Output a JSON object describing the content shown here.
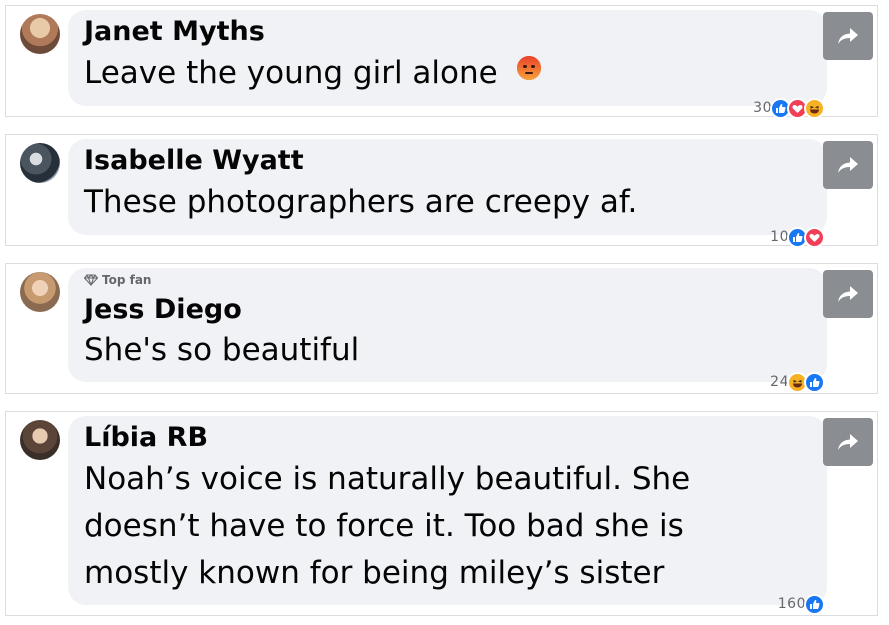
{
  "comments": [
    {
      "author": "Janet Myths",
      "text_lines": [
        "Leave the young girl alone"
      ],
      "inline_emoji": "angry-face-icon",
      "badge": "",
      "reaction_count": "30",
      "reactions": [
        "like-icon",
        "love-icon",
        "haha-icon"
      ]
    },
    {
      "author": "Isabelle Wyatt",
      "text_lines": [
        "These photographers are creepy af."
      ],
      "badge": "",
      "reaction_count": "10",
      "reactions": [
        "like-icon",
        "love-icon"
      ]
    },
    {
      "author": "Jess Diego",
      "text_lines": [
        "She's so beautiful"
      ],
      "badge": "Top fan",
      "reaction_count": "24",
      "reactions": [
        "haha-icon",
        "like-icon"
      ]
    },
    {
      "author": "Líbia RB",
      "text_lines": [
        "Noah’s voice is naturally beautiful. She",
        "doesn’t have to force it. Too bad she is",
        "mostly known for being miley’s sister"
      ],
      "badge": "",
      "reaction_count": "160",
      "reactions": [
        "like-icon"
      ]
    }
  ],
  "colors": {
    "like": "#1877f2",
    "love": "#f33e58",
    "haha": "#f7b125",
    "bubble": "#f0f2f5",
    "share_button": "#8a8d91"
  }
}
